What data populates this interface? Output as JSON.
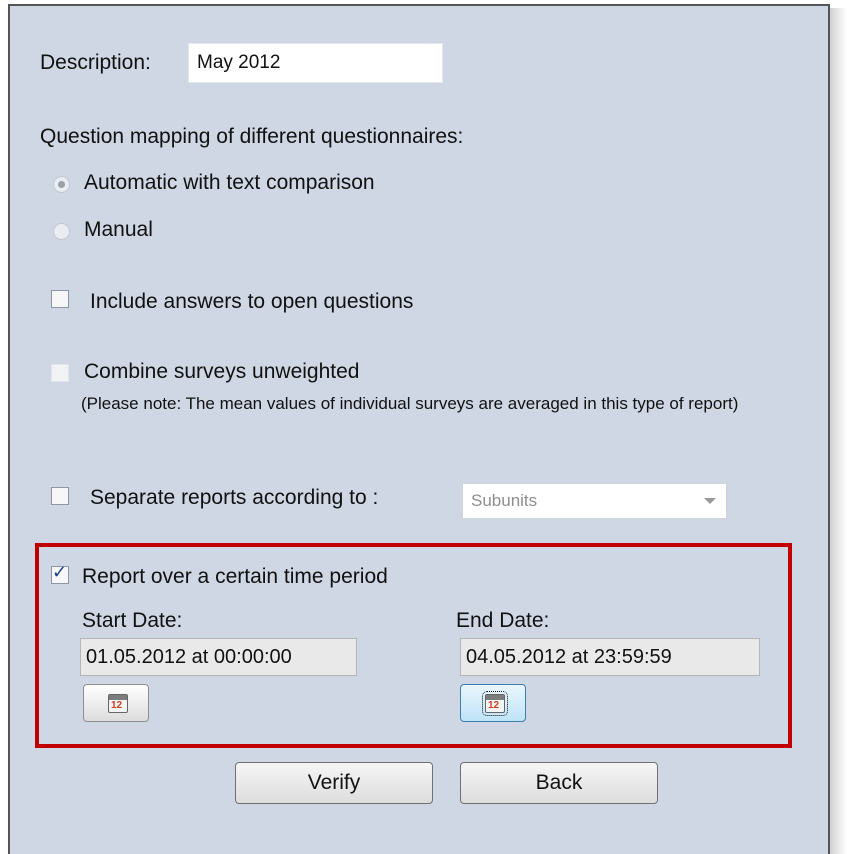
{
  "description": {
    "label": "Description:",
    "value": "May 2012"
  },
  "mapping": {
    "heading": "Question mapping of different questionnaires:",
    "option_auto": "Automatic with text comparison",
    "option_manual": "Manual",
    "selected": "automatic"
  },
  "include_open": {
    "label": "Include answers to open questions",
    "checked": false
  },
  "combine": {
    "label": "Combine surveys unweighted",
    "note": "(Please note: The mean values of individual surveys are averaged in this type of report)",
    "checked": false
  },
  "separate": {
    "label": "Separate reports according to :",
    "select_value": "Subunits",
    "checked": false
  },
  "time_period": {
    "label": "Report over a certain time period",
    "checked": true,
    "checkmark": "✓",
    "start_label": "Start Date:",
    "start_value": "01.05.2012 at 00:00:00",
    "end_label": "End Date:",
    "end_value": "04.05.2012 at 23:59:59",
    "calendar_icon_text": "12"
  },
  "buttons": {
    "verify": "Verify",
    "back": "Back"
  },
  "colors": {
    "panel": "#cfd7e4",
    "highlight": "#c00000"
  }
}
